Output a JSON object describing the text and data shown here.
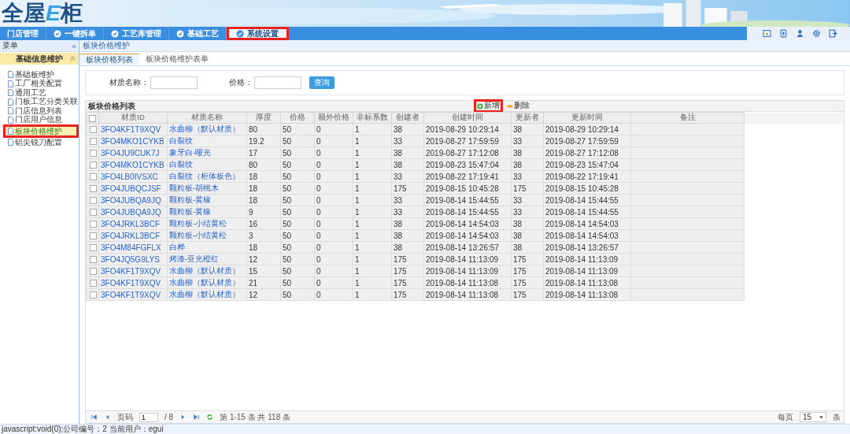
{
  "logo": {
    "parts": [
      "全屋",
      "E",
      "柜"
    ]
  },
  "nav": [
    {
      "label": "门店管理",
      "selected": false,
      "icon": false
    },
    {
      "label": "一键拆单",
      "selected": false,
      "icon": true
    },
    {
      "label": "工艺库管理",
      "selected": false,
      "icon": true
    },
    {
      "label": "基础工艺",
      "selected": false,
      "icon": true
    },
    {
      "label": "系统设置",
      "selected": true,
      "icon": true,
      "highlighted": true
    }
  ],
  "sidebar": {
    "title": "菜单",
    "collapse": "«",
    "group": {
      "label": "基础信息维护",
      "expanded": true
    },
    "items": [
      {
        "label": "基础板维护",
        "selected": false
      },
      {
        "label": "工厂相关配置",
        "selected": false
      },
      {
        "label": "通用工艺",
        "selected": false
      },
      {
        "label": "门板工艺分类关联",
        "selected": false
      },
      {
        "label": "门店信息列表",
        "selected": false
      },
      {
        "label": "门店用户信息",
        "selected": false
      },
      {
        "label": "板块价格维护",
        "selected": true,
        "highlighted": true
      },
      {
        "label": "铝尖锐刀配置",
        "selected": false
      }
    ]
  },
  "breadcrumb": "板块价格维护",
  "tabs": [
    {
      "label": "板块价格列表",
      "selected": true
    },
    {
      "label": "板块价格维护表单",
      "selected": false
    }
  ],
  "search": {
    "fields": [
      {
        "label": "材质名称："
      },
      {
        "label": "价格："
      }
    ],
    "button": "查询"
  },
  "grid": {
    "title": "板块价格列表",
    "all_checked": false,
    "actions": [
      {
        "label": "新增",
        "kind": "add",
        "highlighted": true
      },
      {
        "label": "删除",
        "kind": "delete"
      }
    ],
    "columns": [
      "材质ID",
      "材质名称",
      "厚度",
      "价格",
      "额外价格",
      "非标系数",
      "创建者",
      "创建时间",
      "更新者",
      "更新时间",
      "备注"
    ],
    "rows": [
      {
        "checked": false,
        "cells": [
          "3FO4KF1T9XQV",
          "水曲柳（默认材质）",
          "80",
          "50",
          "0",
          "1",
          "38",
          "2019-08-29 10:29:14",
          "38",
          "2019-08-29 10:29:14"
        ]
      },
      {
        "checked": false,
        "cells": [
          "3FO4MKO1CYKB",
          "白裂纹",
          "19.2",
          "50",
          "0",
          "1",
          "33",
          "2019-08-27 17:59:59",
          "33",
          "2019-08-27 17:59:59"
        ]
      },
      {
        "checked": false,
        "cells": [
          "3FO4JU9CUK7J",
          "象牙白-哑光",
          "17",
          "50",
          "0",
          "1",
          "38",
          "2019-08-27 17:12:08",
          "38",
          "2019-08-27 17:12:08"
        ]
      },
      {
        "checked": false,
        "cells": [
          "3FO4MKO1CYKB",
          "白裂纹",
          "80",
          "50",
          "0",
          "1",
          "38",
          "2019-08-23 15:47:04",
          "38",
          "2019-08-23 15:47:04"
        ]
      },
      {
        "checked": false,
        "cells": [
          "3FO4LB0IVSXC",
          "白裂纹（柜体板色）",
          "18",
          "50",
          "0",
          "1",
          "33",
          "2019-08-22 17:19:41",
          "33",
          "2019-08-22 17:19:41"
        ]
      },
      {
        "checked": false,
        "cells": [
          "3FO4JUBQCJSF",
          "颗粒板-胡桃木",
          "18",
          "50",
          "0",
          "1",
          "175",
          "2019-08-15 10:45:28",
          "175",
          "2019-08-15 10:45:28"
        ]
      },
      {
        "checked": false,
        "cells": [
          "3FO4JUBQA9JQ",
          "颗粒板-黄橡",
          "18",
          "50",
          "0",
          "1",
          "33",
          "2019-08-14 15:44:55",
          "33",
          "2019-08-14 15:44:55"
        ]
      },
      {
        "checked": false,
        "cells": [
          "3FO4JUBQA9JQ",
          "颗粒板-黄橡",
          "9",
          "50",
          "0",
          "1",
          "33",
          "2019-08-14 15:44:55",
          "33",
          "2019-08-14 15:44:55"
        ]
      },
      {
        "checked": false,
        "cells": [
          "3FO4JRKL3BCF",
          "颗粒板-小结黄松",
          "16",
          "50",
          "0",
          "1",
          "38",
          "2019-08-14 14:54:03",
          "38",
          "2019-08-14 14:54:03"
        ]
      },
      {
        "checked": false,
        "cells": [
          "3FO4JRKL3BCF",
          "颗粒板-小结黄松",
          "3",
          "50",
          "0",
          "1",
          "38",
          "2019-08-14 14:54:03",
          "38",
          "2019-08-14 14:54:03"
        ]
      },
      {
        "checked": false,
        "cells": [
          "3FO4M84FGFLX",
          "白桦",
          "18",
          "50",
          "0",
          "1",
          "38",
          "2019-08-14 13:26:57",
          "38",
          "2019-08-14 13:26:57"
        ]
      },
      {
        "checked": false,
        "cells": [
          "3FO4JQ5G9LYS",
          "烤漆-亚光橙红",
          "12",
          "50",
          "0",
          "1",
          "175",
          "2019-08-14 11:13:09",
          "175",
          "2019-08-14 11:13:09"
        ]
      },
      {
        "checked": false,
        "cells": [
          "3FO4KF1T9XQV",
          "水曲柳（默认材质）",
          "15",
          "50",
          "0",
          "1",
          "175",
          "2019-08-14 11:13:09",
          "175",
          "2019-08-14 11:13:09"
        ]
      },
      {
        "checked": false,
        "cells": [
          "3FO4KF1T9XQV",
          "水曲柳（默认材质）",
          "21",
          "50",
          "0",
          "1",
          "175",
          "2019-08-14 11:13:08",
          "175",
          "2019-08-14 11:13:08"
        ]
      },
      {
        "checked": false,
        "cells": [
          "3FO4KF1T9XQV",
          "水曲柳（默认材质）",
          "12",
          "50",
          "0",
          "1",
          "175",
          "2019-08-14 11:13:08",
          "175",
          "2019-08-14 11:13:08"
        ]
      }
    ]
  },
  "pager": {
    "page_label": "页码",
    "page": "1",
    "total_pages": "/ 8",
    "summary": "第 1-15 条  共 118 条",
    "per_page_label": "每页",
    "per_page": "15",
    "unit": "条"
  },
  "status_bar": "javascript:void(0);公司编号：2    当前用户：egui"
}
